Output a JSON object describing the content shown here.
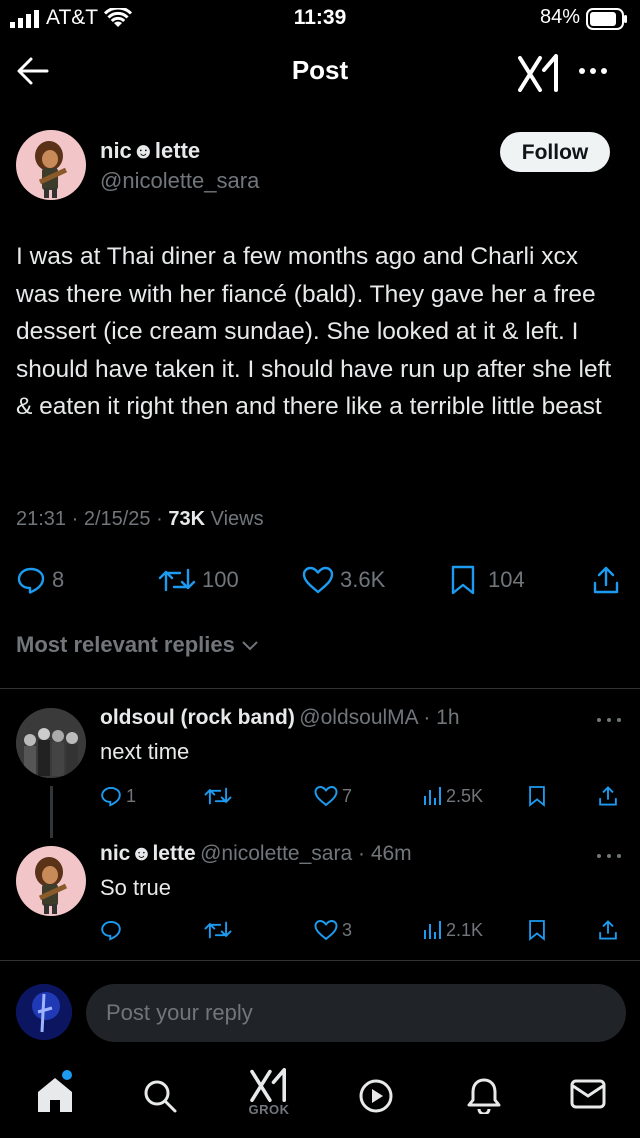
{
  "status_bar": {
    "carrier": "AT&T",
    "time": "11:39",
    "battery": "84%"
  },
  "header": {
    "title": "Post"
  },
  "post": {
    "author_name": "nic☻lette",
    "author_handle": "@nicolette_sara",
    "follow_label": "Follow",
    "text": "I was at Thai diner a few months ago and Charli xcx was there with her fiancé (bald). They gave her a free dessert (ice cream sundae). She looked at it & left. I should have taken it. I should have run up after she left & eaten it right then and there like a terrible little beast",
    "timestamp": "21:31 · 2/15/25 · ",
    "views_count": "73K",
    "views_label": " Views",
    "replies": "8",
    "reposts": "100",
    "likes": "3.6K",
    "bookmarks": "104"
  },
  "replies_section": {
    "sort_label": "Most relevant replies"
  },
  "replies": [
    {
      "name": "oldsoul (rock band)",
      "handle": "@oldsoulMA",
      "time": " · 1h",
      "text": "next time",
      "replies": "1",
      "reposts": "",
      "likes": "7",
      "views": "2.5K"
    },
    {
      "name": "nic☻lette",
      "handle": "@nicolette_sara",
      "time": " · 46m",
      "text": "So true",
      "replies": "",
      "reposts": "",
      "likes": "3",
      "views": "2.1K"
    }
  ],
  "composer": {
    "placeholder": "Post your reply"
  },
  "tabbar": {
    "grok_label": "GROK"
  },
  "colors": {
    "background": "#000000",
    "text": "#e7e9ea",
    "muted": "#71767b",
    "follow_bg": "#eff3f4",
    "notification_dot": "#1d9bf0"
  }
}
